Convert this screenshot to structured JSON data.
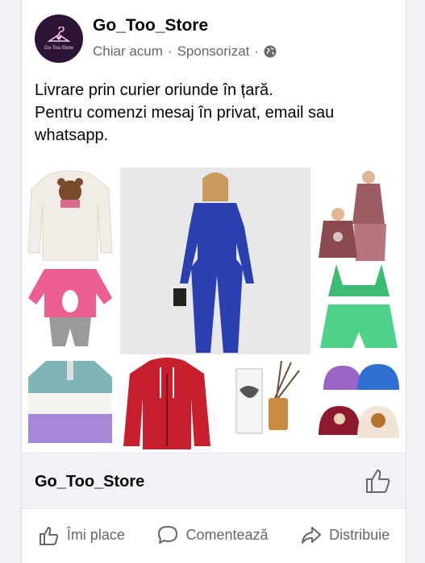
{
  "post": {
    "page_name": "Go_Too_Store",
    "time": "Chiar acum",
    "separator": "·",
    "sponsored": "Sponsorizat",
    "privacy_icon": "globe-icon",
    "avatar_text": "Go-Too-Store",
    "text_lines": [
      "Livrare prin curier oriunde în țară.",
      "Pentru comenzi mesaj în privat, email sau",
      "whatsapp."
    ]
  },
  "link": {
    "title": "Go_Too_Store",
    "icon": "thumbs-up-icon"
  },
  "actions": {
    "like": "Îmi place",
    "comment": "Comentează",
    "share": "Distribuie"
  },
  "colors": {
    "avatar_bg": "#2b1436",
    "meta_text": "#65676b",
    "link_bar_bg": "#f0f2f5"
  }
}
